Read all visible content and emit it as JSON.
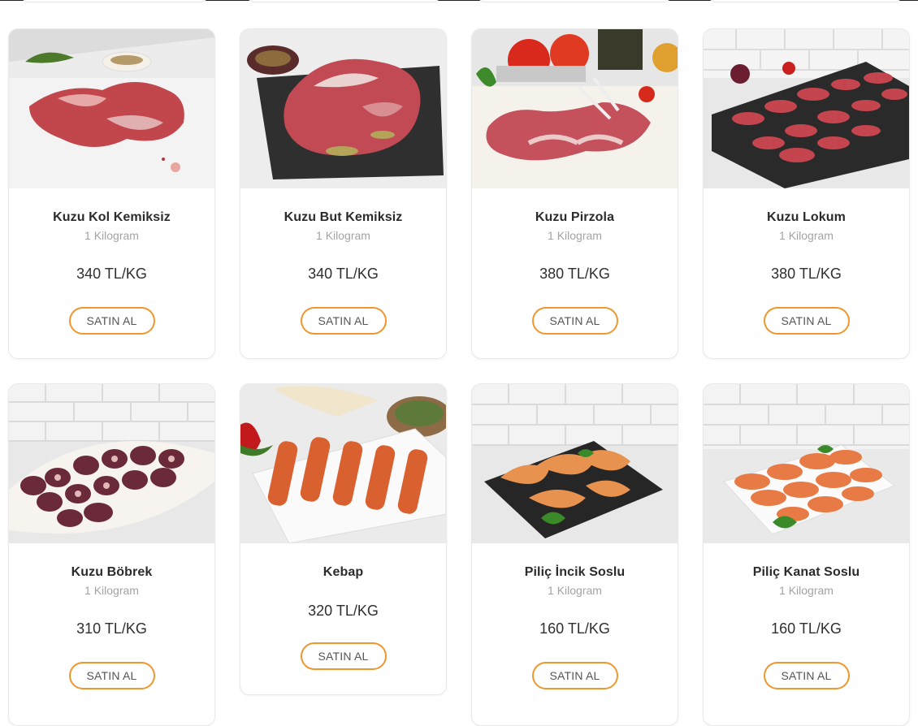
{
  "products": [
    {
      "name": "Kuzu Kol Kemiksiz",
      "unit": "1 Kilogram",
      "price": "340 TL/KG",
      "button": "SATIN AL",
      "image": "lamb-shoulder-boneless-photo"
    },
    {
      "name": "Kuzu But Kemiksiz",
      "unit": "1 Kilogram",
      "price": "340 TL/KG",
      "button": "SATIN AL",
      "image": "lamb-leg-boneless-photo"
    },
    {
      "name": "Kuzu Pirzola",
      "unit": "1 Kilogram",
      "price": "380 TL/KG",
      "button": "SATIN AL",
      "image": "lamb-chops-photo"
    },
    {
      "name": "Kuzu Lokum",
      "unit": "1 Kilogram",
      "price": "380 TL/KG",
      "button": "SATIN AL",
      "image": "lamb-tenderloin-slices-photo"
    },
    {
      "name": "Kuzu Böbrek",
      "unit": "1 Kilogram",
      "price": "310 TL/KG",
      "button": "SATIN AL",
      "image": "lamb-kidney-photo"
    },
    {
      "name": "Kebap",
      "price": "320 TL/KG",
      "button": "SATIN AL",
      "image": "kebab-skewers-photo"
    },
    {
      "name": "Piliç İncik Soslu",
      "unit": "1 Kilogram",
      "price": "160 TL/KG",
      "button": "SATIN AL",
      "image": "chicken-drumstick-sauced-photo"
    },
    {
      "name": "Piliç Kanat Soslu",
      "unit": "1 Kilogram",
      "price": "160 TL/KG",
      "button": "SATIN AL",
      "image": "chicken-wings-sauced-photo"
    }
  ],
  "colors": {
    "accent": "#f0962c",
    "title": "#2b2b2b",
    "muted": "#a3a3a3"
  }
}
